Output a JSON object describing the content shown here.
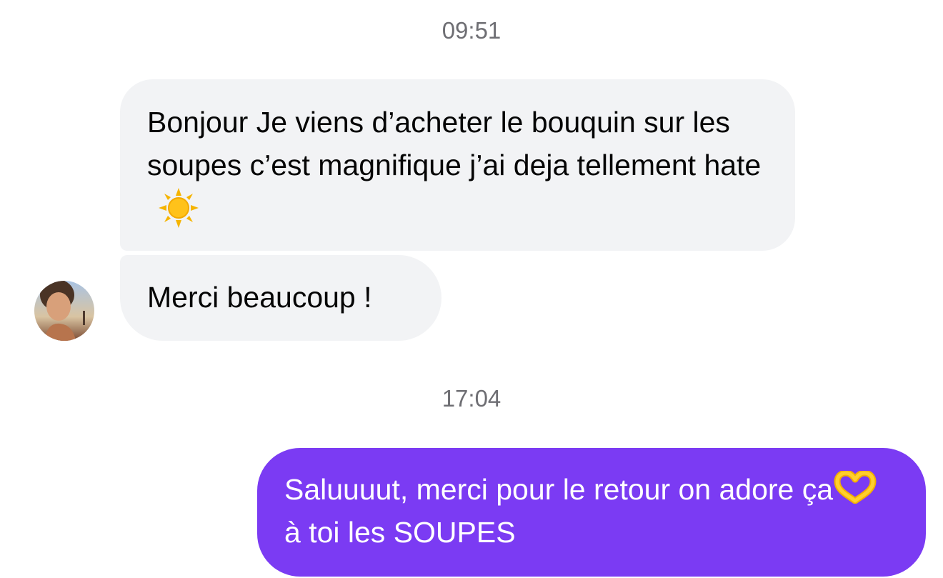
{
  "conversation": {
    "timestamps": [
      "09:51",
      "17:04"
    ],
    "messages": [
      {
        "direction": "incoming",
        "text": "Bonjour Je viens d’acheter le bouquin sur les soupes c’est magnifique j’ai deja tellement hate",
        "emoji": "sun-icon"
      },
      {
        "direction": "incoming",
        "text": "Merci beaucoup !"
      },
      {
        "direction": "outgoing",
        "text_before_emoji": "Saluuuut, merci pour le retour on adore ça",
        "emoji": "heart-hands-icon",
        "text_after_emoji": "à toi les SOUPES"
      }
    ],
    "contact_avatar": "avatar"
  },
  "colors": {
    "incoming_bubble": "#f2f3f5",
    "outgoing_bubble": "#7b3bf3",
    "timestamp_text": "#6e6e73"
  }
}
